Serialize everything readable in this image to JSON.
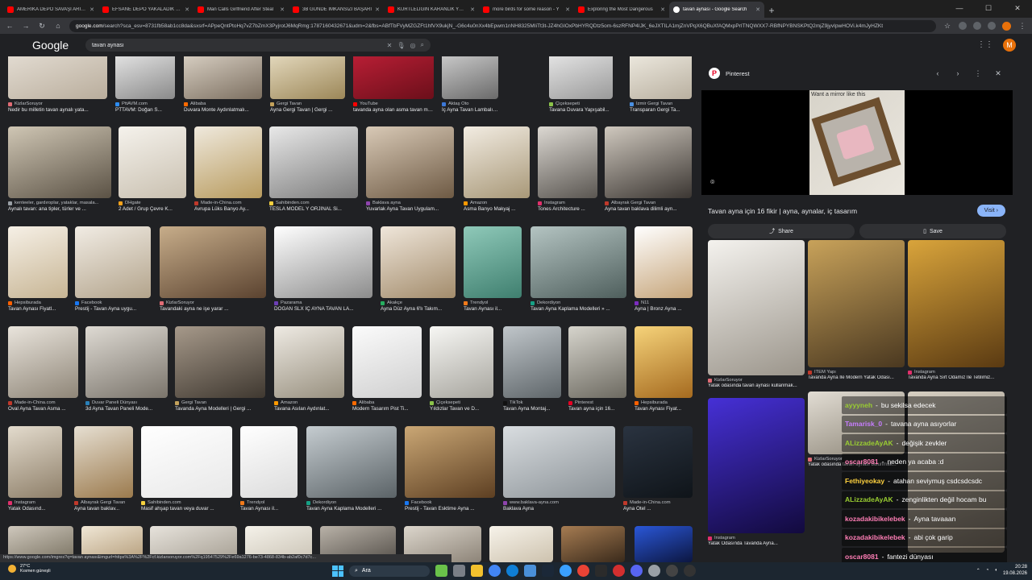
{
  "tabs": [
    {
      "label": "AMERİKA DEPO SAVAŞI ARI - YouTube",
      "fav": "youtube"
    },
    {
      "label": "EFSANE DEPO YAKALADIK / STI",
      "fav": "youtube"
    },
    {
      "label": "Man Calls Girlfriend After Steal",
      "fav": "youtube"
    },
    {
      "label": "3B GÜNDE İMKANSIZI BAŞARI",
      "fav": "youtube"
    },
    {
      "label": "KURTLELİĞİN KARANLIK YÜZÜ",
      "fav": "youtube"
    },
    {
      "label": "more birds for some reason - Y",
      "fav": "youtube"
    },
    {
      "label": "Exploring the Most Dangerous",
      "fav": "youtube"
    },
    {
      "label": "tavan aynası - Google Search",
      "fav": "google",
      "active": true
    }
  ],
  "url_host": "google.com",
  "url_rest": "/search?sca_esv=8731fb58ab1cc8da&sxsrf=APpeQntPtoHq7vZ7bZmX3PyjrotJ6MqRmg:1787160432671&udm=2&fbs=ABfTbFVyMZGZFt1hfVX9ukjN_-G6c4u0nXx4bEpwm1nNH8325MIiTt3t-JZ4hGIOxPbHYRQDtz5om-6szRFNP4IJK_6eJXTILA1mjZnVPqX6QBuXfAQMxpPrITNQWXX7-RBfNPYBNSKPtQ2mjZ9jyvIpwHOVi.k4mJyHZKt",
  "google_logo": "Google",
  "search_query": "tavan aynası",
  "avatar_letter": "M",
  "results": [
    [
      {
        "source": "KizlarSoruyor",
        "title": "Nedir bu milletin tavan aynalı yata...",
        "fav": "#e06c75",
        "bg": "linear-gradient(160deg,#e9e3da,#b9ad9c)"
      },
      {
        "source": "PttAVM.com",
        "title": "PTTAVM: Doğan S...",
        "fav": "#2d8cf0",
        "bg": "linear-gradient(160deg,#f4f4f4,#8a8a8a)"
      },
      {
        "source": "Alibaba",
        "title": "Duvara Monte Aydınlatmalı...",
        "fav": "#ff6a00",
        "bg": "linear-gradient(160deg,#e7dfd3,#7c6f60)"
      },
      {
        "source": "Gergi Tavan",
        "title": "Ayna Gergi Tavan | Gergi ...",
        "fav": "#c3a15b",
        "bg": "linear-gradient(160deg,#f0e7cf,#9c8758)"
      },
      {
        "source": "YouTube",
        "title": "tavanda ayna olan asma tavan mo...",
        "fav": "#ff0000",
        "bg": "linear-gradient(160deg,#c7213a,#6b0f1a)"
      },
      {
        "source": "Aktaş Oto",
        "title": "İç Ayna Tavan Lambalı Do...",
        "fav": "#3c78d8",
        "bg": "linear-gradient(160deg,#dcdcdc,#6a6a6a)"
      },
      {
        "source": "Çiçeksepeti",
        "title": "Tavana Duvara Yapışabil...",
        "fav": "#8bc34a",
        "bg": "linear-gradient(160deg,#f2f2f2,#9a9a9a)"
      },
      {
        "source": "İzmir Gergi Tavan",
        "title": "Transparan Gergi Ta...",
        "fav": "#4a90e2",
        "bg": "linear-gradient(160deg,#f6f3ea,#b9b0a0)"
      }
    ],
    [
      {
        "source": "kenteeler, gardıroplar, yataklar, masala...",
        "title": "Aynalı tavan: ana tipler, türler ve ...",
        "fav": "#9aa0a6",
        "bg": "linear-gradient(160deg,#cfc6b4,#5b5245)"
      },
      {
        "source": "DHgate",
        "title": "2 Adet / Grup Çevre K...",
        "fav": "#f7a21b",
        "bg": "linear-gradient(160deg,#f5f2ec,#c9c0b0)"
      },
      {
        "source": "Made-in-China.com",
        "title": "Avrupa Lüks Banyo Ay...",
        "fav": "#c0392b",
        "bg": "linear-gradient(160deg,#efe9dd,#b89b5e)"
      },
      {
        "source": "Sahibinden.com",
        "title": "TESLA MODEL Y ORJİNAL Si...",
        "fav": "#f4d03f",
        "bg": "linear-gradient(160deg,#e8e8e8,#7d7d7d)"
      },
      {
        "source": "Baklava ayna",
        "title": "Yuvarlak Ayna Tavan Uygulam...",
        "fav": "#8e44ad",
        "bg": "linear-gradient(160deg,#d8c9b6,#6e5a44)"
      },
      {
        "source": "Amazon",
        "title": "Asma Banyo Makyaj ...",
        "fav": "#ff9900",
        "bg": "linear-gradient(160deg,#f2ece2,#a89878)"
      },
      {
        "source": "Instagram",
        "title": "Tones Architecture ...",
        "fav": "#e1306c",
        "bg": "linear-gradient(160deg,#dcd8d2,#5a5651)"
      },
      {
        "source": "Albayrak Gergi Tavan",
        "title": "Ayna tavan baklava dilimli ayn...",
        "fav": "#c0392b",
        "bg": "linear-gradient(160deg,#cfc8be,#3b3632)"
      }
    ],
    [
      {
        "source": "Hepsiburada",
        "title": "Tavan Aynası Fiyatl...",
        "fav": "#ff6000",
        "bg": "linear-gradient(160deg,#f6f0e6,#c7b594)"
      },
      {
        "source": "Facebook",
        "title": "Prestij - Tavan Ayna uygu...",
        "fav": "#1877f2",
        "bg": "linear-gradient(160deg,#f1ece4,#b3a48c)"
      },
      {
        "source": "KizlarSoruyor",
        "title": "Tavandaki ayna ne işe yarar ...",
        "fav": "#e06c75",
        "bg": "linear-gradient(160deg,#c7ad8a,#5b4330)"
      },
      {
        "source": "Pazarama",
        "title": "DOGAN SLX İÇ AYNA TAVAN LA...",
        "fav": "#6c3fb5",
        "bg": "linear-gradient(160deg,#ffffff,#8c8c8c)"
      },
      {
        "source": "Akakçe",
        "title": "Ayna Düz Ayna 6'lı Takım...",
        "fav": "#27ae60",
        "bg": "linear-gradient(160deg,#efe6da,#a38c6c)"
      },
      {
        "source": "Trendyol",
        "title": "Tavan Aynası il...",
        "fav": "#f27a1a",
        "bg": "linear-gradient(160deg,#8fc9b9,#3f7f6f)"
      },
      {
        "source": "Dekordiyon",
        "title": "Tavan Ayna Kaplama Modelleri » ...",
        "fav": "#16a085",
        "bg": "linear-gradient(160deg,#b4c4c2,#4f5f5d)"
      },
      {
        "source": "N11",
        "title": "Ayna | Bronz Ayna ...",
        "fav": "#7b2cbf",
        "bg": "linear-gradient(160deg,#ffffff,#c6a57a)"
      }
    ],
    [
      {
        "source": "Made-in-China.com",
        "title": "Oval Ayna Tavan Asma ...",
        "fav": "#c0392b",
        "bg": "linear-gradient(160deg,#e9e4dc,#8f8678)"
      },
      {
        "source": "Duvar Paneli Dünyası",
        "title": "3d Ayna Tavan Paneli Mode...",
        "fav": "#2980b9",
        "bg": "linear-gradient(160deg,#dedad3,#7a746b)"
      },
      {
        "source": "Gergi Tavan",
        "title": "Tavanda Ayna Modelleri | Gergi ...",
        "fav": "#c3a15b",
        "bg": "linear-gradient(160deg,#a6998a,#3f3830)"
      },
      {
        "source": "Amazon",
        "title": "Tavana Asılan Aydınlat...",
        "fav": "#ff9900",
        "bg": "linear-gradient(160deg,#eeeae3,#98907f)"
      },
      {
        "source": "Alibaba",
        "title": "Modern Tasarım Pist Ti...",
        "fav": "#ff6a00",
        "bg": "linear-gradient(160deg,#fbfbfb,#cfcfcf)"
      },
      {
        "source": "Çiçeksepeti",
        "title": "Yıldızlar Tavan ve D...",
        "fav": "#8bc34a",
        "bg": "linear-gradient(160deg,#f7f7f4,#a7a59e)"
      },
      {
        "source": "TikTok",
        "title": "Tavan Ayna Montaj...",
        "fav": "#111111",
        "bg": "linear-gradient(160deg,#c0c6ca,#5f666a)"
      },
      {
        "source": "Pinterest",
        "title": "Tavan ayna için 16...",
        "fav": "#e60023",
        "bg": "linear-gradient(160deg,#d6d4cc,#6d6a61)"
      },
      {
        "source": "Hepsiburada",
        "title": "Tavan Aynası Fiyat...",
        "fav": "#ff6000",
        "bg": "linear-gradient(160deg,#f6d37a,#a56a1f)"
      }
    ],
    [
      {
        "source": "Instagram",
        "title": "Yatak Odasınd...",
        "fav": "#e1306c",
        "bg": "linear-gradient(160deg,#e3dbcd,#8e7f69)"
      },
      {
        "source": "Albayrak Gergi Tavan",
        "title": "Ayna tavan baklav...",
        "fav": "#c0392b",
        "bg": "linear-gradient(160deg,#e6dfd2,#9b7a4d)"
      },
      {
        "source": "Sahibinden.com",
        "title": "Masif ahşap tavan veya duvar ...",
        "fav": "#f4d03f",
        "bg": "linear-gradient(160deg,#ffffff,#e8e8e8)"
      },
      {
        "source": "Trendyol",
        "title": "Tavan Aynası il...",
        "fav": "#f27a1a",
        "bg": "linear-gradient(160deg,#ffffff,#dcdcdc)"
      },
      {
        "source": "Dekordiyon",
        "title": "Tavan Ayna Kaplama Modelleri ...",
        "fav": "#16a085",
        "bg": "linear-gradient(160deg,#c5ccd0,#5b6367)"
      },
      {
        "source": "Facebook",
        "title": "Prestij - Tavan Esktime Ayna ...",
        "fav": "#1877f2",
        "bg": "linear-gradient(160deg,#caa775,#5d3f22)"
      },
      {
        "source": "www.baklava-ayna.com",
        "title": "Baklava Ayna",
        "fav": "#8e44ad",
        "bg": "linear-gradient(160deg,#d9dde0,#8a9196)"
      },
      {
        "source": "Made-in-China.com",
        "title": "Ayna Otel ...",
        "fav": "#c0392b",
        "bg": "linear-gradient(160deg,#2a3340,#0f1419)"
      }
    ],
    [
      {
        "source": "",
        "title": "",
        "fav": "#9aa0a6",
        "bg": "linear-gradient(160deg,#cfc8bd,#77705f)"
      },
      {
        "source": "",
        "title": "",
        "fav": "#9aa0a6",
        "bg": "linear-gradient(160deg,#f0e7d6,#b39b78)"
      },
      {
        "source": "",
        "title": "",
        "fav": "#9aa0a6",
        "bg": "linear-gradient(160deg,#e7e3dc,#a49d91)"
      },
      {
        "source": "",
        "title": "",
        "fav": "#9aa0a6",
        "bg": "linear-gradient(160deg,#f5f2ea,#c9c2b4)"
      },
      {
        "source": "",
        "title": "",
        "fav": "#9aa0a6",
        "bg": "linear-gradient(160deg,#b9b2a8,#55504a)"
      },
      {
        "source": "",
        "title": "",
        "fav": "#9aa0a6",
        "bg": "linear-gradient(160deg,#dcd6cc,#8d8478)"
      },
      {
        "source": "",
        "title": "",
        "fav": "#9aa0a6",
        "bg": "linear-gradient(160deg,#f7f3ea,#cdc2ae)"
      },
      {
        "source": "",
        "title": "",
        "fav": "#9aa0a6",
        "bg": "linear-gradient(160deg,#a67c52,#3a2a1b)"
      },
      {
        "source": "",
        "title": "",
        "fav": "#9aa0a6",
        "bg": "linear-gradient(160deg,#2a57d8,#0c1640)"
      }
    ]
  ],
  "panel": {
    "source": "Pinterest",
    "image_caption": "Want a mirror like this",
    "title": "Tavan ayna için 16 fikir | ayna, aynalar, iç tasarım",
    "visit_label": "Visit",
    "share_label": "Share",
    "save_label": "Save",
    "related": [
      {
        "source": "KizlarSoruyor",
        "title": "Yatak odasında tavan aynası kullanmak...",
        "fav": "#e06c75",
        "bg": "linear-gradient(160deg,#f4f2ee,#9b958b)"
      },
      {
        "source": "ITEM Yapı",
        "title": "Tavanda Ayna İle Modern Yatak Odası...",
        "fav": "#c0392b",
        "bg": "linear-gradient(160deg,#c8a25a,#4a3820)"
      },
      {
        "source": "Instagram",
        "title": "Tavanda Ayna Sırt Odamız İle Tetilimiz...",
        "fav": "#e1306c",
        "bg": "linear-gradient(160deg,#d9a43b,#5a3a12)"
      },
      {
        "source": "Instagram",
        "title": "Yatak Odasında Tavanda Ayna...",
        "fav": "#e1306c",
        "bg": "linear-gradient(160deg,#4630d6,#120a3d)"
      },
      {
        "source": "KizlarSoruyor",
        "title": "Yatak odasında tavan aynası bulunmak...",
        "fav": "#e06c75",
        "bg": "linear-gradient(160deg,#e2ddd4,#8c8577)"
      },
      {
        "source": "",
        "title": "",
        "fav": "#9aa0a6",
        "bg": "linear-gradient(160deg,#d6cfc2,#6f665a)"
      }
    ]
  },
  "chat": [
    {
      "user": "ayyyneh",
      "msg": "bu sekilsa edecek",
      "color": "#9acd32"
    },
    {
      "user": "Tamarisk_0",
      "msg": "tavana ayna asıyorlar",
      "color": "#c77dff"
    },
    {
      "user": "ALizzadeAyAK",
      "msg": "değişik zevkler",
      "color": "#9acd32"
    },
    {
      "user": "oscar8081",
      "msg": "neden ya acaba :d",
      "color": "#ff7eb6"
    },
    {
      "user": "Fethiyeokay",
      "msg": "atahan seviymuş csdcsdcsdc",
      "color": "#ffd23f"
    },
    {
      "user": "ALizzadeAyAK",
      "msg": "zenginlikten değil hocam bu",
      "color": "#9acd32"
    },
    {
      "user": "kozadakibikelebek",
      "msg": "Ayna tavaaan",
      "color": "#ff7eb6"
    },
    {
      "user": "kozadakibikelebek",
      "msg": "abi çok garip",
      "color": "#ff7eb6"
    },
    {
      "user": "oscar8081",
      "msg": "fantezi dünyası",
      "color": "#ff7eb6"
    }
  ],
  "status_url": "https://www.google.com/imgres?q=tavan aynası&imgurl=https%3A%2F%2Fcf.kizlarsoruyor.com%2Fq19547529%2Fe69a1276-be73-4868-834b-ab2af0c7d7c...",
  "taskbar": {
    "weather_temp": "27°C",
    "weather_desc": "Kısmen güneşli",
    "search_label": "Ara",
    "time": "20:28",
    "date": "19.08.2026"
  },
  "colors": {
    "accent": "#8ab4f8",
    "panel_bg": "#202124",
    "youtube": "#ff0000"
  }
}
